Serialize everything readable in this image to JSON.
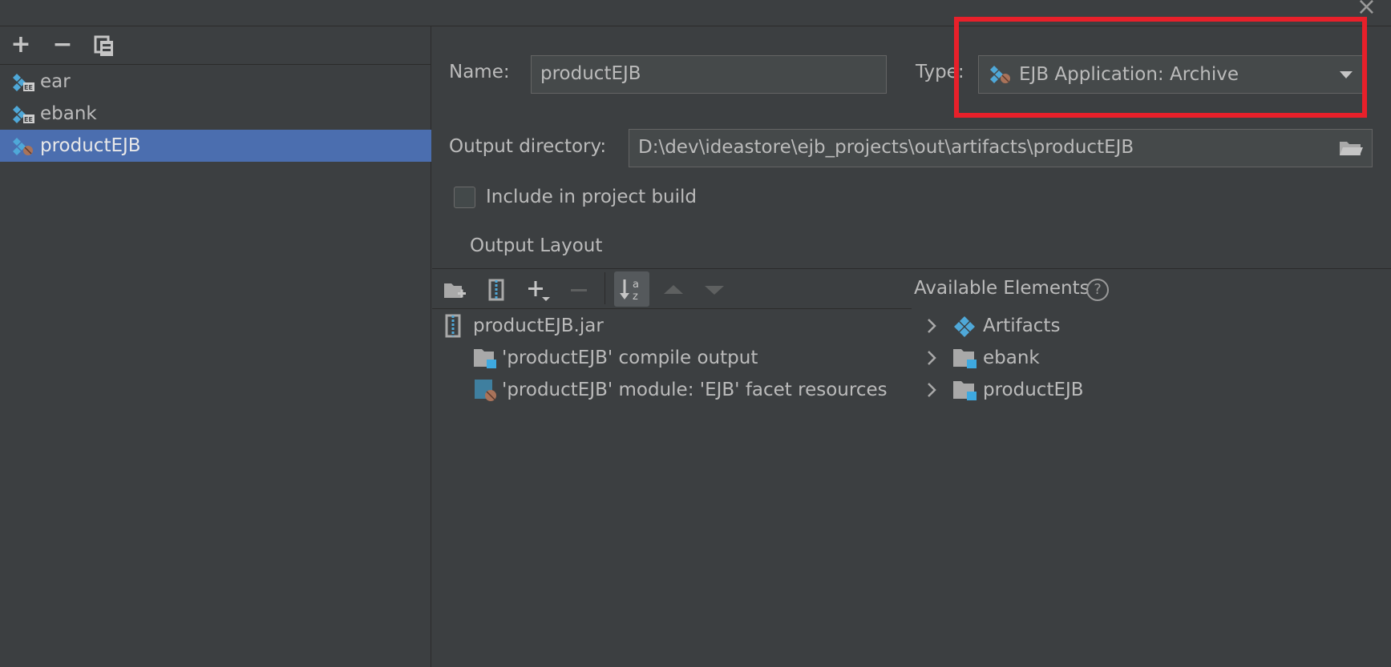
{
  "window": {
    "close_label": "×"
  },
  "left_toolbar": {
    "add_label": "+",
    "remove_label": "−"
  },
  "artifacts": [
    {
      "label": "ear"
    },
    {
      "label": "ebank"
    },
    {
      "label": "productEJB",
      "selected": true
    }
  ],
  "form": {
    "name_label": "Name:",
    "name_value": "productEJB",
    "type_label": "Type:",
    "type_value": "EJB Application: Archive",
    "output_dir_label": "Output directory:",
    "output_dir_value": "D:\\dev\\ideastore\\ejb_projects\\out\\artifacts\\productEJB",
    "include_build_label": "Include in project build",
    "include_build_checked": false
  },
  "output_layout": {
    "tab_label": "Output Layout",
    "tree": [
      {
        "label": "productEJB.jar",
        "icon": "jar-icon"
      },
      {
        "label": "'productEJB' compile output",
        "icon": "module-output-icon"
      },
      {
        "label": "'productEJB' module: 'EJB' facet resources",
        "icon": "facet-resources-icon"
      }
    ]
  },
  "available_elements": {
    "title": "Available Elements",
    "help_label": "?",
    "items": [
      {
        "label": "Artifacts",
        "icon": "artifacts-icon"
      },
      {
        "label": "ebank",
        "icon": "module-folder-icon"
      },
      {
        "label": "productEJB",
        "icon": "module-folder-icon"
      }
    ]
  },
  "colors": {
    "background": "#3c3f41",
    "selection": "#4b6eaf",
    "highlight_box": "#e8202a",
    "field_bg": "#45494a"
  }
}
